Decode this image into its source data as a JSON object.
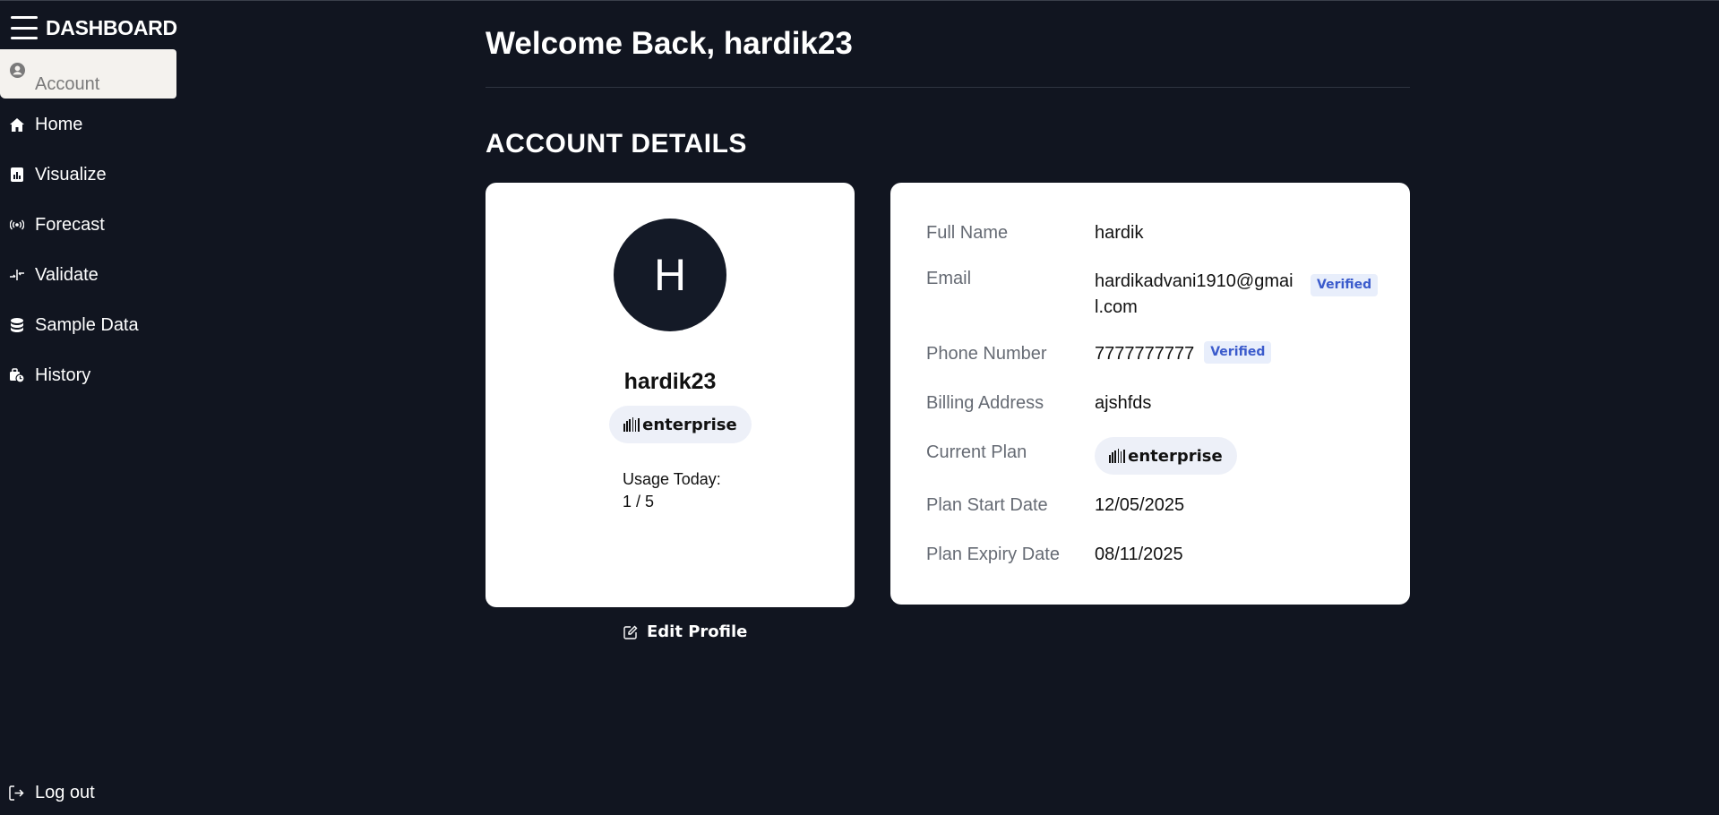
{
  "sidebar": {
    "brand": "DASHBOARD",
    "items": [
      {
        "label": "Account",
        "icon": "user-circle-icon"
      },
      {
        "label": "Home",
        "icon": "home-icon"
      },
      {
        "label": "Visualize",
        "icon": "chart-icon"
      },
      {
        "label": "Forecast",
        "icon": "broadcast-icon"
      },
      {
        "label": "Validate",
        "icon": "compare-icon"
      },
      {
        "label": "Sample Data",
        "icon": "database-icon"
      },
      {
        "label": "History",
        "icon": "history-icon"
      }
    ],
    "logout": "Log out"
  },
  "header": {
    "welcome": "Welcome Back, hardik23"
  },
  "section_title": "ACCOUNT DETAILS",
  "profile": {
    "avatar_letter": "H",
    "username": "hardik23",
    "plan": "enterprise",
    "usage_label": "Usage Today:",
    "usage_value": "1 / 5",
    "edit_label": "Edit Profile"
  },
  "details": {
    "full_name_label": "Full Name",
    "full_name": "hardik",
    "email_label": "Email",
    "email": "hardikadvani1910@gmail.com",
    "email_status": "Verified",
    "phone_label": "Phone Number",
    "phone": "7777777777",
    "phone_status": "Verified",
    "billing_label": "Billing Address",
    "billing": "ajshfds",
    "plan_label": "Current Plan",
    "plan": "enterprise",
    "start_label": "Plan Start Date",
    "start": "12/05/2025",
    "expiry_label": "Plan Expiry Date",
    "expiry": "08/11/2025"
  },
  "colors": {
    "background": "#111520",
    "card": "#ffffff",
    "badge_text": "#3b5bcc",
    "badge_bg": "#e8eefb"
  }
}
